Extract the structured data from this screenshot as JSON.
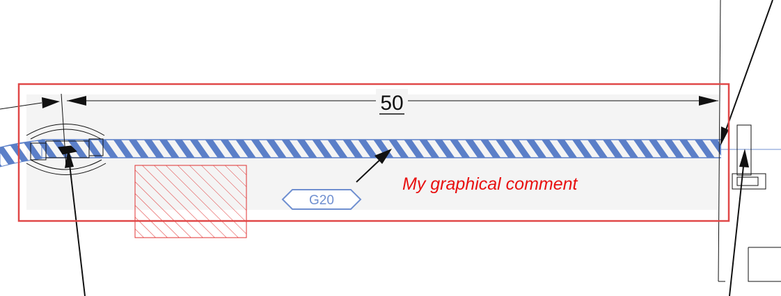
{
  "dimension": {
    "value": "50"
  },
  "tag": {
    "label": "G20"
  },
  "comment": {
    "text": "My graphical comment"
  },
  "colors": {
    "selection": "#e04848",
    "pipe": "#5b7fc8",
    "tag": "#6f8fd0",
    "comment": "#e81010",
    "hatch": "#e03030",
    "ink": "#111111",
    "panel": "#f4f4f4"
  }
}
